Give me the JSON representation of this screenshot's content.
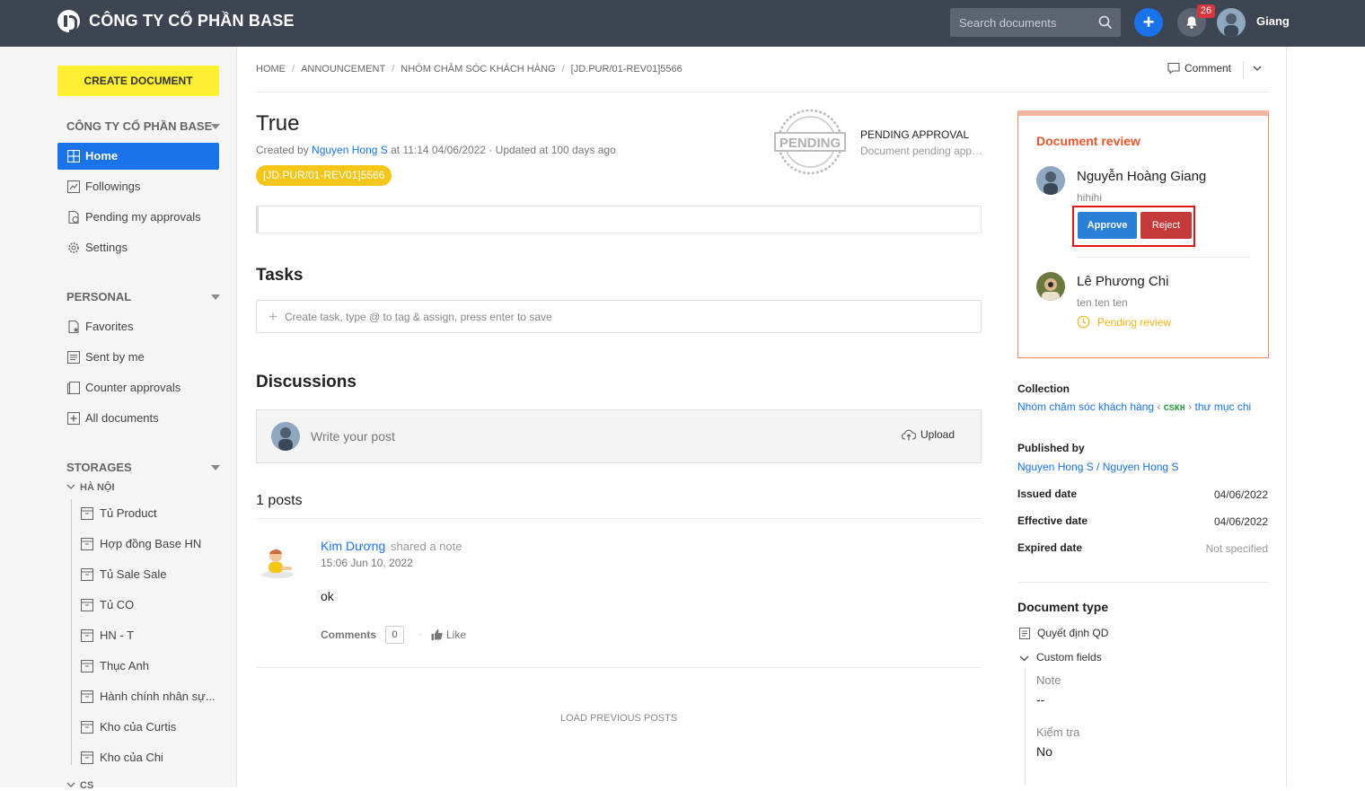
{
  "header": {
    "company": "CÔNG TY CỔ PHẦN BASE",
    "search_placeholder": "Search documents",
    "notification_count": "26",
    "username": "Giang"
  },
  "sidebar": {
    "create_label": "CREATE DOCUMENT",
    "company_section": "CÔNG TY CỔ PHẦN BASE",
    "nav": [
      {
        "label": "Home",
        "icon": "grid-icon"
      },
      {
        "label": "Followings",
        "icon": "chart-icon"
      },
      {
        "label": "Pending my approvals",
        "icon": "document-clock-icon"
      },
      {
        "label": "Settings",
        "icon": "gear-icon"
      }
    ],
    "personal_section": "PERSONAL",
    "personal": [
      {
        "label": "Favorites",
        "icon": "star-document-icon"
      },
      {
        "label": "Sent by me",
        "icon": "document-icon"
      },
      {
        "label": "Counter approvals",
        "icon": "documents-icon"
      },
      {
        "label": "All documents",
        "icon": "plus-square-icon"
      }
    ],
    "storages_section": "STORAGES",
    "storage_root": "HÀ NỘI",
    "storages": [
      "Tủ Product",
      "Hợp đồng Base HN",
      "Tủ Sale Sale",
      "Tủ CO",
      "HN - T",
      "Thục Anh",
      "Hành chính nhân sự...",
      "Kho của Curtis",
      "Kho của Chi"
    ],
    "next_root": "CS"
  },
  "breadcrumb": [
    "HOME",
    "ANNOUNCEMENT",
    "NHÓM CHĂM SÓC KHÁCH HÀNG",
    "[JD.PUR/01-REV01]5566"
  ],
  "toolbar": {
    "comment_label": "Comment"
  },
  "document": {
    "title": "True",
    "created_prefix": "Created by ",
    "author": "Nguyen Hong S",
    "created_suffix": " at 11:14 04/06/2022 · Updated at 100 days ago",
    "code": "[JD.PUR/01-REV01]5566",
    "stamp_text": "PENDING",
    "status_title": "PENDING APPROVAL",
    "status_sub": "Document pending approval"
  },
  "tasks": {
    "heading": "Tasks",
    "placeholder": "Create task, type @ to tag & assign, press enter to save"
  },
  "discussions": {
    "heading": "Discussions",
    "placeholder": "Write your post",
    "upload_label": "Upload",
    "posts_count": "1 posts",
    "posts": [
      {
        "author": "Kim Dương",
        "action": "shared a note",
        "time": "15:06 Jun 10, 2022",
        "body": "ok",
        "comments_label": "Comments",
        "comments_count": "0",
        "like_label": "Like"
      }
    ],
    "load_previous": "LOAD PREVIOUS POSTS"
  },
  "review": {
    "title": "Document review",
    "reviewers": [
      {
        "name": "Nguyễn Hoàng Giang",
        "note": "hihihi"
      },
      {
        "name": "Lê Phương Chi",
        "note": "ten ten ten",
        "status": "Pending review"
      }
    ],
    "approve_label": "Approve",
    "reject_label": "Reject"
  },
  "info": {
    "collection_label": "Collection",
    "collection_link1": "Nhóm chăm sóc khách hàng",
    "collection_tag": "CSKH",
    "collection_link2": "thư mục chi",
    "published_label": "Published by",
    "published_value": "Nguyen Hong S / Nguyen Hong S",
    "issued_label": "Issued date",
    "issued_value": "04/06/2022",
    "effective_label": "Effective date",
    "effective_value": "04/06/2022",
    "expired_label": "Expired date",
    "expired_value": "Not specified"
  },
  "doctype": {
    "title": "Document type",
    "value": "Quyết định QD",
    "custom_fields_label": "Custom fields",
    "fields": [
      {
        "label": "Note",
        "value": "--"
      },
      {
        "label": "Kiểm tra",
        "value": "No"
      }
    ]
  },
  "colors": {
    "topbar": "#3c4551",
    "accent": "#1a73e8",
    "create": "#ffee32",
    "review_border": "#ef8a69",
    "reject": "#c43a3a"
  }
}
